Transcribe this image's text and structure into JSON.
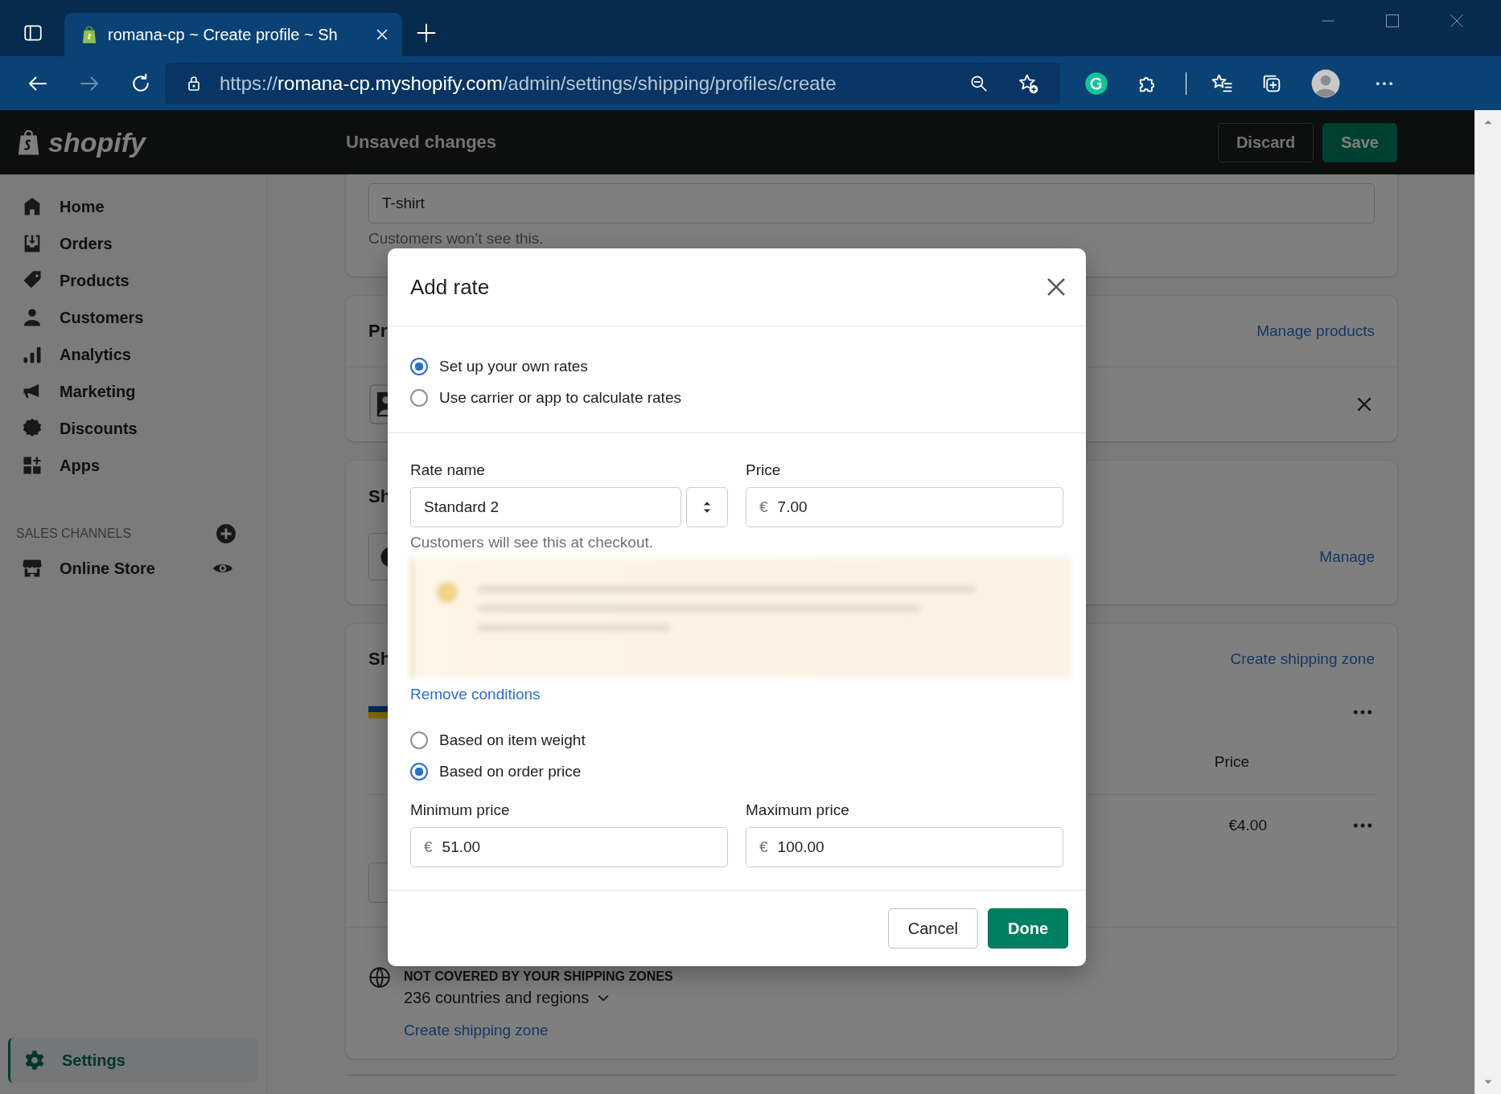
{
  "browser": {
    "tab_title": "romana-cp ~ Create profile ~ Sh",
    "url": {
      "prefix": "https://",
      "host": "romana-cp.myshopify.com",
      "path": "/admin/settings/shipping/profiles/create"
    },
    "forward_disabled": true
  },
  "topbar": {
    "logo": "shopify",
    "title": "Unsaved changes",
    "buttons": [
      {
        "label": "Discard",
        "kind": "secondary"
      },
      {
        "label": "Save",
        "kind": "primary"
      }
    ]
  },
  "sidebar": {
    "items": [
      {
        "label": "Home",
        "selected": false
      },
      {
        "label": "Orders",
        "selected": false
      },
      {
        "label": "Products",
        "selected": false
      },
      {
        "label": "Customers",
        "selected": false
      },
      {
        "label": "Analytics",
        "selected": false
      },
      {
        "label": "Marketing",
        "selected": false
      },
      {
        "label": "Discounts",
        "selected": false
      },
      {
        "label": "Apps",
        "selected": false
      }
    ],
    "section_title": "SALES CHANNELS",
    "channels": [
      {
        "label": "Online Store"
      }
    ],
    "settings": {
      "label": "Settings",
      "selected": true
    }
  },
  "page": {
    "name_field": {
      "value": "T-shirt",
      "help": "Customers won’t see this."
    },
    "products_card": {
      "heading": "Pr",
      "link": "Manage products"
    },
    "origin_card": {
      "heading": "Sh",
      "link": "Manage"
    },
    "zones_card": {
      "heading": "Sh",
      "link": "Create shipping zone",
      "column": "Price",
      "row_price": "€4.00",
      "not_covered_title": "NOT COVERED BY YOUR SHIPPING ZONES",
      "not_covered_count": "236 countries and regions",
      "bottom_link": "Create shipping zone"
    }
  },
  "modal": {
    "title": "Add rate",
    "rate_types": [
      {
        "label": "Set up your own rates",
        "selected": true
      },
      {
        "label": "Use carrier or app to calculate rates",
        "selected": false
      }
    ],
    "rate_name": {
      "label": "Rate name",
      "value": "Standard 2",
      "help": "Customers will see this at checkout."
    },
    "price": {
      "label": "Price",
      "currency": "€",
      "value": "7.00"
    },
    "remove_link": "Remove conditions",
    "conditions": [
      {
        "label": "Based on item weight",
        "selected": false
      },
      {
        "label": "Based on order price",
        "selected": true
      }
    ],
    "min_price": {
      "label": "Minimum price",
      "currency": "€",
      "value": "51.00"
    },
    "max_price": {
      "label": "Maximum price",
      "currency": "€",
      "value": "100.00"
    },
    "buttons": [
      {
        "label": "Cancel",
        "kind": "secondary"
      },
      {
        "label": "Done",
        "kind": "primary"
      }
    ]
  }
}
